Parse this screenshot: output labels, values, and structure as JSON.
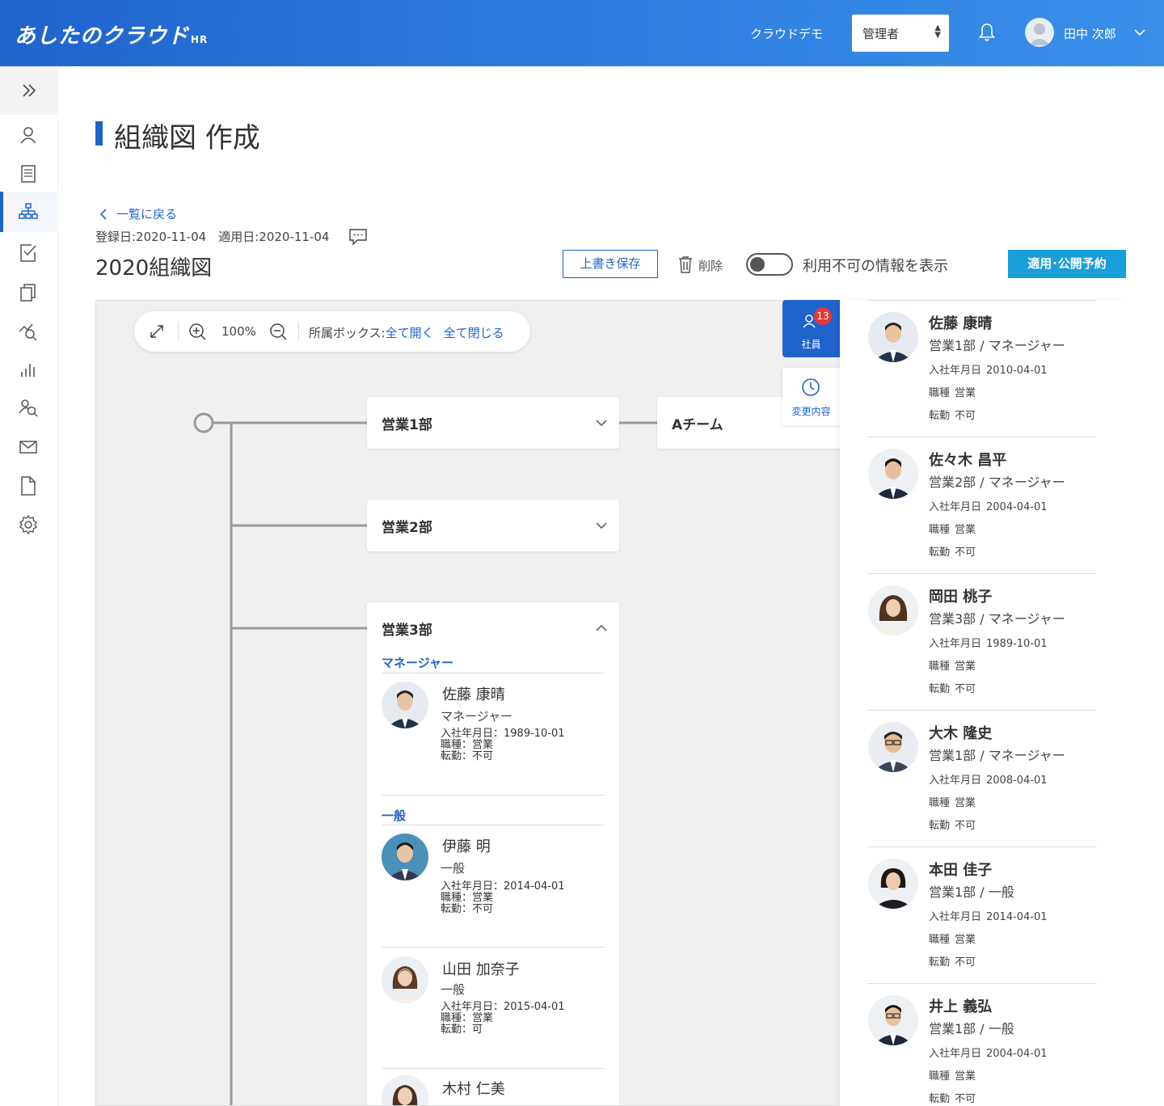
{
  "header": {
    "logo": "あしたのクラウド",
    "logo_suffix": "HR",
    "demo_label": "クラウドデモ",
    "role": "管理者",
    "user_name": "田中 次郎"
  },
  "sidebar": {
    "items": [
      "expand-icon",
      "person-icon",
      "document-icon",
      "org-chart-icon",
      "checklist-icon",
      "copy-icon",
      "analysis-icon",
      "bar-chart-icon",
      "people-search-icon",
      "mail-icon",
      "file-icon",
      "gear-icon"
    ]
  },
  "page": {
    "title": "組織図 作成",
    "back_link": "一覧に戻る",
    "dates": "登録日:2020-11-04　適用日:2020-11-04",
    "chart_name": "2020組織図",
    "save_label": "上書き保存",
    "delete_label": "削除",
    "toggle_label": "利用不可の情報を表示",
    "toggle_on": false,
    "apply_label": "適用･公開予約"
  },
  "toolbar": {
    "zoom": "100%",
    "box_label": "所属ボックス:",
    "open_all": "全て開く",
    "close_all": "全て閉じる"
  },
  "org": {
    "nodes": [
      {
        "name": "営業1部",
        "expanded": false
      },
      {
        "name": "Aチーム",
        "expanded": false
      },
      {
        "name": "営業2部",
        "expanded": false
      },
      {
        "name": "営業3部",
        "expanded": true
      }
    ],
    "dept3": {
      "sections": [
        {
          "label": "マネージャー",
          "members": [
            {
              "name": "佐藤 康晴",
              "role": "マネージャー",
              "info": [
                "入社年月日：1989-10-01",
                "職種：営業",
                "転勤：不可"
              ]
            }
          ]
        },
        {
          "label": "一般",
          "members": [
            {
              "name": "伊藤 明",
              "role": "一般",
              "info": [
                "入社年月日：2014-04-01",
                "職種：営業",
                "転勤：不可"
              ]
            },
            {
              "name": "山田 加奈子",
              "role": "一般",
              "info": [
                "入社年月日：2015-04-01",
                "職種：営業",
                "転勤：可"
              ]
            },
            {
              "name": "木村 仁美",
              "role": "",
              "info": []
            }
          ]
        }
      ]
    }
  },
  "panel_tabs": {
    "employees_label": "社員",
    "employees_count": "13",
    "changes_label": "変更内容"
  },
  "employees": [
    {
      "name": "佐藤 康晴",
      "dept": "営業1部 / マネージャー",
      "join_label": "入社年月日",
      "join": "2010-04-01",
      "job_label": "職種",
      "job": "営業",
      "transfer_label": "転勤",
      "transfer": "不可"
    },
    {
      "name": "佐々木 昌平",
      "dept": "営業2部 / マネージャー",
      "join_label": "入社年月日",
      "join": "2004-04-01",
      "job_label": "職種",
      "job": "営業",
      "transfer_label": "転勤",
      "transfer": "不可"
    },
    {
      "name": "岡田 桃子",
      "dept": "営業3部 / マネージャー",
      "join_label": "入社年月日",
      "join": "1989-10-01",
      "job_label": "職種",
      "job": "営業",
      "transfer_label": "転勤",
      "transfer": "不可"
    },
    {
      "name": "大木 隆史",
      "dept": "営業1部 / マネージャー",
      "join_label": "入社年月日",
      "join": "2008-04-01",
      "job_label": "職種",
      "job": "営業",
      "transfer_label": "転勤",
      "transfer": "不可"
    },
    {
      "name": "本田 佳子",
      "dept": "営業1部 / 一般",
      "join_label": "入社年月日",
      "join": "2014-04-01",
      "job_label": "職種",
      "job": "営業",
      "transfer_label": "転勤",
      "transfer": "不可"
    },
    {
      "name": "井上 義弘",
      "dept": "営業1部 / 一般",
      "join_label": "入社年月日",
      "join": "2004-04-01",
      "job_label": "職種",
      "job": "営業",
      "transfer_label": "転勤",
      "transfer": "不可"
    }
  ],
  "colors": {
    "primary": "#1f63cc",
    "apply": "#1a9ed9",
    "badge": "#e53935"
  }
}
